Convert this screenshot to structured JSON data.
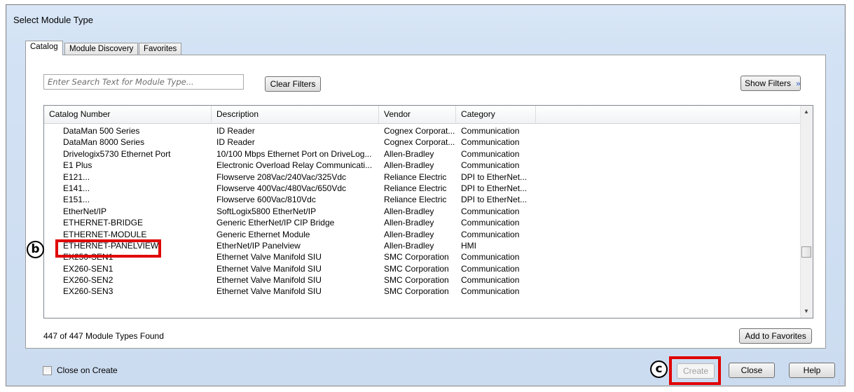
{
  "window": {
    "title": "Select Module Type"
  },
  "tabs": [
    {
      "label": "Catalog",
      "active": true
    },
    {
      "label": "Module Discovery",
      "active": false
    },
    {
      "label": "Favorites",
      "active": false
    }
  ],
  "search": {
    "placeholder": "Enter Search Text for Module Type..."
  },
  "buttons": {
    "clear_filters": "Clear Filters",
    "show_filters": "Show Filters",
    "show_filters_icon": "double-chevron-down-icon",
    "add_to_favorites": "Add to Favorites",
    "create": "Create",
    "close": "Close",
    "help": "Help"
  },
  "table": {
    "columns": [
      "Catalog Number",
      "Description",
      "Vendor",
      "Category"
    ],
    "rows": [
      [
        "DataMan 500 Series",
        "ID Reader",
        "Cognex Corporat...",
        "Communication"
      ],
      [
        "DataMan 8000 Series",
        "ID Reader",
        "Cognex Corporat...",
        "Communication"
      ],
      [
        "Drivelogix5730 Ethernet Port",
        "10/100 Mbps Ethernet Port on DriveLog...",
        "Allen-Bradley",
        "Communication"
      ],
      [
        "E1 Plus",
        "Electronic Overload Relay Communicati...",
        "Allen-Bradley",
        "Communication"
      ],
      [
        "E121...",
        "Flowserve 208Vac/240Vac/325Vdc",
        "Reliance Electric",
        "DPI to EtherNet..."
      ],
      [
        "E141...",
        "Flowserve 400Vac/480Vac/650Vdc",
        "Reliance Electric",
        "DPI to EtherNet..."
      ],
      [
        "E151...",
        "Flowserve 600Vac/810Vdc",
        "Reliance Electric",
        "DPI to EtherNet..."
      ],
      [
        "EtherNet/IP",
        "SoftLogix5800 EtherNet/IP",
        "Allen-Bradley",
        "Communication"
      ],
      [
        "ETHERNET-BRIDGE",
        "Generic EtherNet/IP CIP Bridge",
        "Allen-Bradley",
        "Communication"
      ],
      [
        "ETHERNET-MODULE",
        "Generic Ethernet Module",
        "Allen-Bradley",
        "Communication"
      ],
      [
        "ETHERNET-PANELVIEW",
        "EtherNet/IP Panelview",
        "Allen-Bradley",
        "HMI"
      ],
      [
        "EX250-SEN1",
        "Ethernet Valve Manifold SIU",
        "SMC Corporation",
        "Communication"
      ],
      [
        "EX260-SEN1",
        "Ethernet Valve Manifold SIU",
        "SMC Corporation",
        "Communication"
      ],
      [
        "EX260-SEN2",
        "Ethernet Valve Manifold SIU",
        "SMC Corporation",
        "Communication"
      ],
      [
        "EX260-SEN3",
        "Ethernet Valve Manifold SIU",
        "SMC Corporation",
        "Communication"
      ]
    ]
  },
  "status": {
    "found_text": "447  of 447 Module Types Found"
  },
  "options": {
    "close_on_create_label": "Close on Create",
    "close_on_create_checked": false
  },
  "annotations": {
    "marker_b": "b",
    "marker_c": "c",
    "highlight_color": "#e00000"
  }
}
